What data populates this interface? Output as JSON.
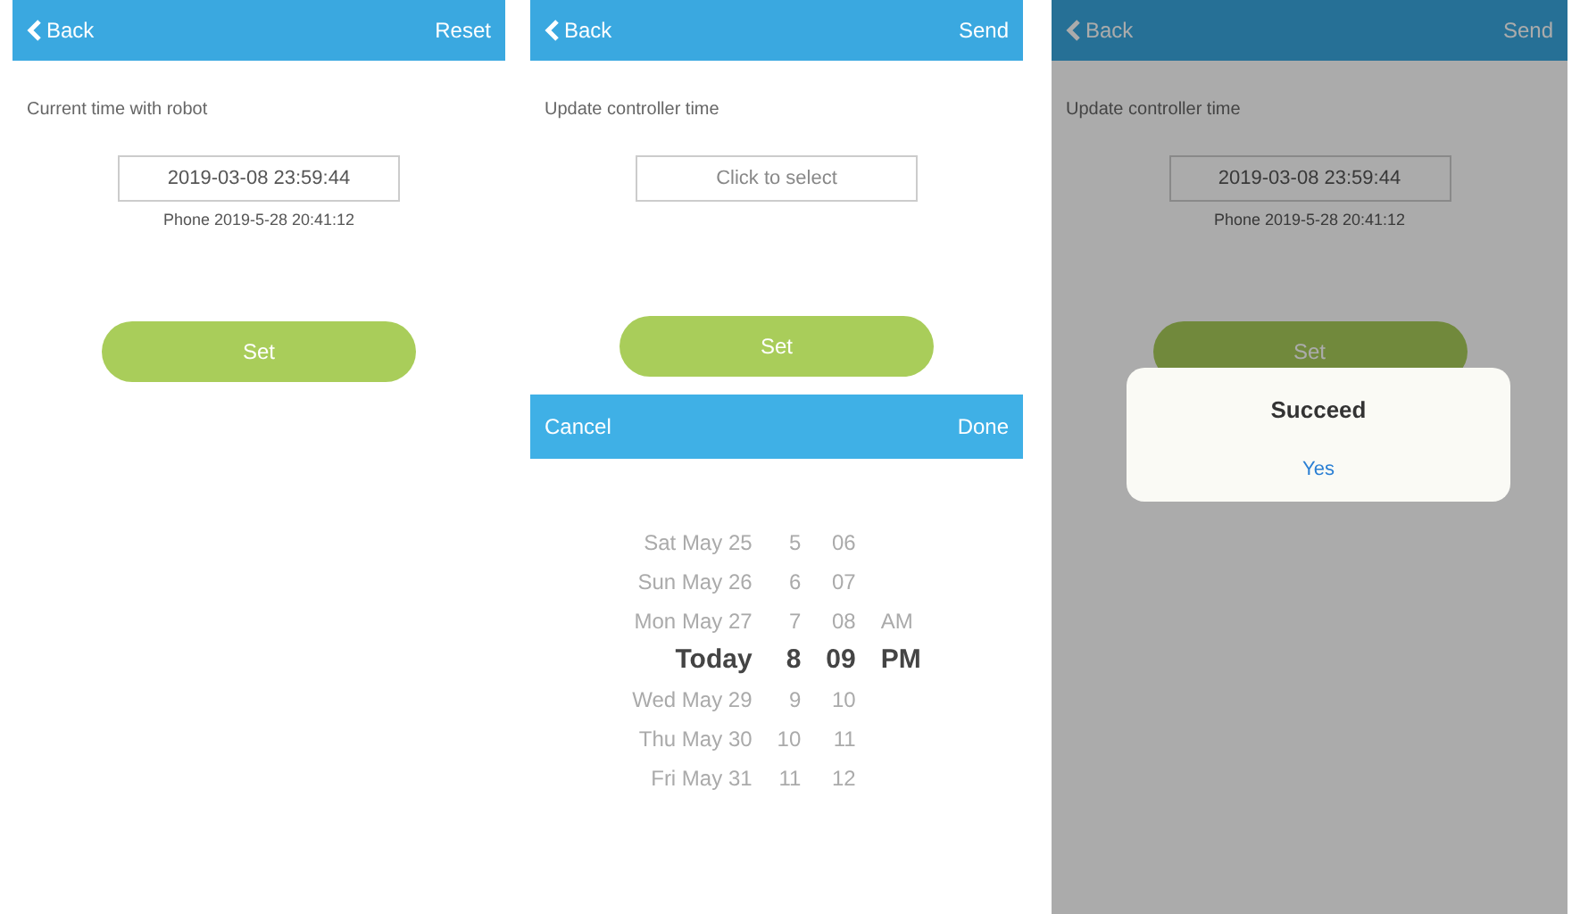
{
  "screens": [
    {
      "header": {
        "back": "Back",
        "action": "Reset"
      },
      "label": "Current time with robot",
      "field": {
        "value": "2019-03-08 23:59:44"
      },
      "note": "Phone 2019-5-28 20:41:12",
      "button": "Set",
      "dimmed": false
    },
    {
      "header": {
        "back": "Back",
        "action": "Send"
      },
      "label": "Update controller time",
      "field": {
        "placeholder": "Click to select"
      },
      "button": "Set",
      "dimmed": false,
      "picker": {
        "cancel": "Cancel",
        "done": "Done",
        "columns": [
          {
            "kind": "date",
            "items": [
              {
                "text": "Sat May 25",
                "selected": false
              },
              {
                "text": "Sun May 26",
                "selected": false
              },
              {
                "text": "Mon May 27",
                "selected": false
              },
              {
                "text": "Today",
                "selected": true
              },
              {
                "text": "Wed May 29",
                "selected": false
              },
              {
                "text": "Thu May 30",
                "selected": false
              },
              {
                "text": "Fri May 31",
                "selected": false
              }
            ]
          },
          {
            "kind": "hour",
            "items": [
              {
                "text": "5",
                "selected": false
              },
              {
                "text": "6",
                "selected": false
              },
              {
                "text": "7",
                "selected": false
              },
              {
                "text": "8",
                "selected": true
              },
              {
                "text": "9",
                "selected": false
              },
              {
                "text": "10",
                "selected": false
              },
              {
                "text": "11",
                "selected": false
              }
            ]
          },
          {
            "kind": "minute",
            "items": [
              {
                "text": "06",
                "selected": false
              },
              {
                "text": "07",
                "selected": false
              },
              {
                "text": "08",
                "selected": false
              },
              {
                "text": "09",
                "selected": true
              },
              {
                "text": "10",
                "selected": false
              },
              {
                "text": "11",
                "selected": false
              },
              {
                "text": "12",
                "selected": false
              }
            ]
          },
          {
            "kind": "ampm",
            "items": [
              {
                "text": "AM",
                "selected": false
              },
              {
                "text": "PM",
                "selected": true
              }
            ]
          }
        ]
      }
    },
    {
      "header": {
        "back": "Back",
        "action": "Send"
      },
      "label": "Update controller time",
      "field": {
        "value": "2019-03-08 23:59:44"
      },
      "note": "Phone 2019-5-28 20:41:12",
      "button": "Set",
      "dimmed": true,
      "dialog": {
        "title": "Succeed",
        "button": "Yes"
      }
    }
  ]
}
